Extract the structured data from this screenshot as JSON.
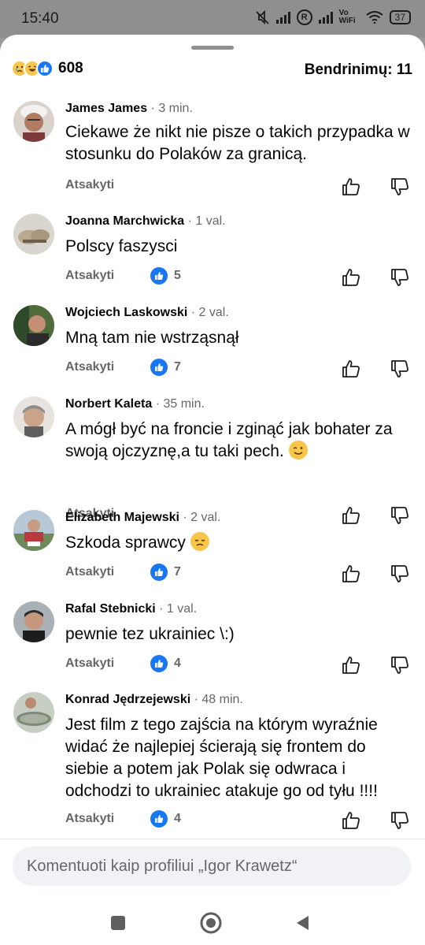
{
  "status_bar": {
    "time": "15:40",
    "network_r": "R",
    "volte": "Vo WiFi",
    "battery": "37",
    "icons": [
      "mute-icon",
      "signal-icon",
      "roaming-icon",
      "signal-icon",
      "volte-wifi-icon",
      "wifi-icon",
      "battery-icon"
    ]
  },
  "summary": {
    "reaction_icons": [
      "sad-reaction-icon",
      "haha-reaction-icon",
      "like-reaction-icon"
    ],
    "reaction_count": "608",
    "shares": "Bendrinimų: 11"
  },
  "comments": [
    {
      "author": "James James",
      "time": "· 3 min.",
      "text": "Ciekawe że nikt nie pisze o takich przypadka w stosunku do Polaków za granicą.",
      "reply": "Atsakyti",
      "likes": ""
    },
    {
      "author": "Joanna Marchwicka",
      "time": "· 1 val.",
      "text": "Polscy faszysci",
      "reply": "Atsakyti",
      "likes": "5"
    },
    {
      "author": "Wojciech Laskowski",
      "time": "· 2 val.",
      "text": "Mną tam nie wstrząsnął",
      "reply": "Atsakyti",
      "likes": "7"
    },
    {
      "author": "Norbert Kaleta",
      "time": "· 35 min.",
      "text": "A mógł być na froncie i zginąć jak bohater za swoją ojczyznę,a tu taki pech.",
      "reply": "Atsakyti",
      "likes": "",
      "emoji": "winking-face-emoji"
    },
    {
      "author": "Elizabeth Majewski",
      "time": "· 2 val.",
      "text": "Szkoda sprawcy",
      "reply": "Atsakyti",
      "likes": "7",
      "emoji": "sad-face-emoji"
    },
    {
      "author": "Rafal Stebnicki",
      "time": "· 1 val.",
      "text": "pewnie tez ukrainiec \\:)",
      "reply": "Atsakyti",
      "likes": "4"
    },
    {
      "author": "Konrad Jędrzejewski",
      "time": "· 48 min.",
      "text": "Jest film z tego zajścia na którym wyraźnie widać że najlepiej ścierają się frontem do siebie a potem jak Polak się odwraca i odchodzi to ukrainiec atakuje go od tyłu !!!!",
      "reply": "Atsakyti",
      "likes": "4"
    }
  ],
  "composer": {
    "placeholder": "Komentuoti kaip profiliui „Igor Krawetz“"
  },
  "nav": {
    "icons": [
      "recents-square-icon",
      "home-circle-icon",
      "back-triangle-icon"
    ]
  },
  "colors": {
    "accent": "#1877f2",
    "secondary_text": "#65676b",
    "composer_bg": "#f0f2f5"
  }
}
